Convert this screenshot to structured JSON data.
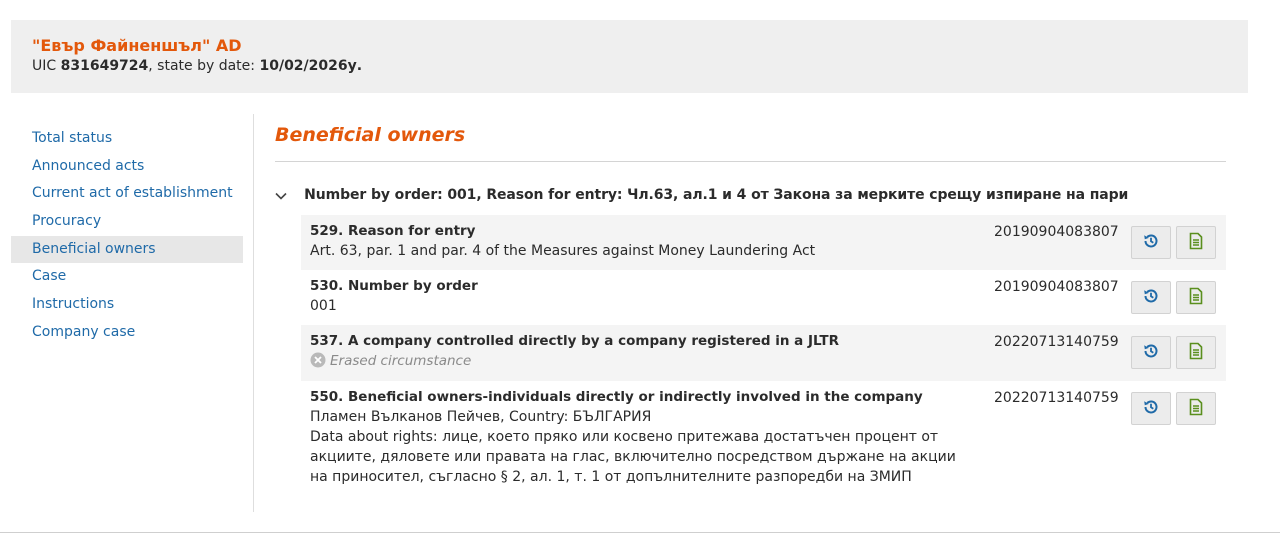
{
  "company": {
    "name": "\"Евър Файненшъл\" AD",
    "uic_label": "UIC",
    "uic": "831649724",
    "state_label": ", state by date:",
    "state_date": "10/02/2026у."
  },
  "sidebar": {
    "items": [
      {
        "label": "Total status"
      },
      {
        "label": "Announced acts"
      },
      {
        "label": "Current act of establishment"
      },
      {
        "label": "Procuracy"
      },
      {
        "label": "Beneficial owners",
        "active": true
      },
      {
        "label": "Case"
      },
      {
        "label": "Instructions"
      },
      {
        "label": "Company case"
      }
    ]
  },
  "main": {
    "title": "Beneficial owners",
    "group": {
      "title": "Number by order: 001, Reason for entry: Чл.63, ал.1 и 4 от Закона за мерките срещу изпиране на пари",
      "expanded": true
    },
    "rows": [
      {
        "label": "529. Reason for entry",
        "value": "Art. 63, par. 1 and par. 4 of the Measures against Money Laundering Act",
        "number": "20190904083807"
      },
      {
        "label": "530. Number by order",
        "value": "001",
        "number": "20190904083807"
      },
      {
        "label": "537. A company controlled directly by a company registered in a JLTR",
        "value": "Erased circumstance",
        "number": "20220713140759"
      },
      {
        "label": "550. Beneficial owners-individuals directly or indirectly involved in the company",
        "value": "Пламен Вълканов Пейчев, Country: БЪЛГАРИЯ",
        "value2": "Data about rights: лице, което пряко или косвено притежава достатъчен процент от акциите, дяловете или правата на глас, включително посредством държане на акции на приносител, съгласно § 2, ал. 1, т. 1 от допълнителните разпоредби на ЗМИП",
        "number": "20220713140759"
      }
    ]
  },
  "colors": {
    "accent": "#e3580b",
    "link": "#1f6aa8",
    "history_icon": "#1f6aa8",
    "doc_icon": "#5a8f1e"
  },
  "icons": {
    "chevron": "chevron-down-icon",
    "history": "history-icon",
    "document": "document-icon",
    "erased": "x-circle-icon"
  }
}
